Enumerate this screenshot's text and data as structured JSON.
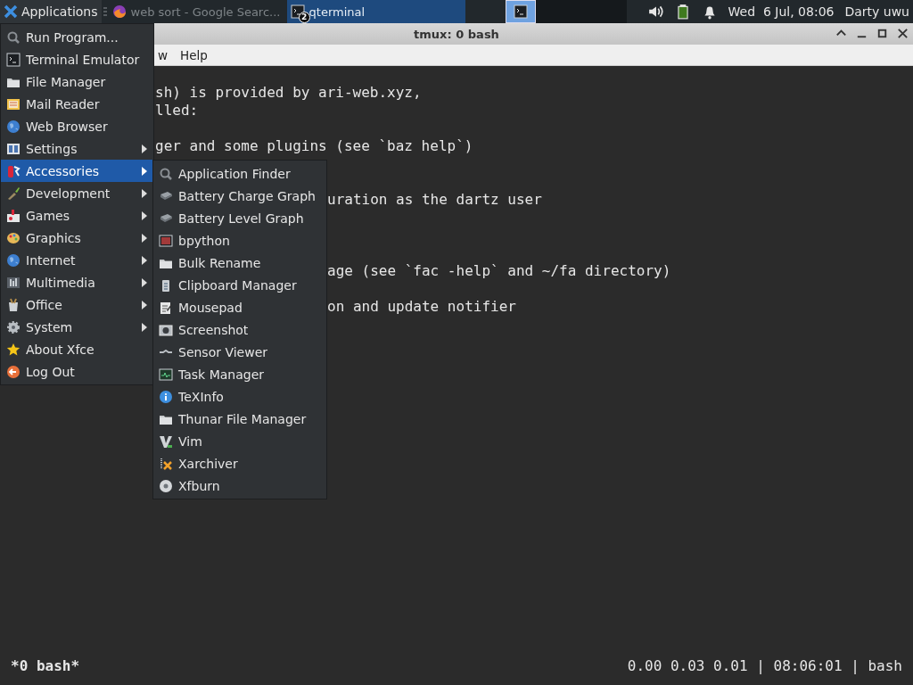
{
  "taskbar": {
    "apps_button": "Applications",
    "tasks": [
      {
        "label": "web sort - Google Searc...",
        "selected": false
      },
      {
        "label": "qterminal",
        "selected": true,
        "badge": "2"
      }
    ],
    "workspaces": [
      {
        "selected": true
      },
      {
        "selected": false
      },
      {
        "selected": false
      },
      {
        "selected": false
      }
    ],
    "clock": "Wed  6 Jul, 08:06",
    "user": "Darty uwu"
  },
  "window": {
    "title": "tmux: 0 bash",
    "menus": [
      "w",
      "Help"
    ]
  },
  "terminal": {
    "lines": [
      {
        "kind": "menu",
        "text": "sh) is provided by ari-web.xyz,"
      },
      {
        "kind": "menu",
        "text": "lled:"
      },
      {
        "kind": "blank"
      },
      {
        "kind": "menu",
        "text": "ger and some plugins (see `baz help`)"
      },
      {
        "kind": "blank"
      },
      {
        "kind": "blank"
      },
      {
        "kind": "submenu",
        "text": "uration as the dartz user"
      },
      {
        "kind": "blank"
      },
      {
        "kind": "blank"
      },
      {
        "kind": "blank"
      },
      {
        "kind": "submenu",
        "text": "age (see `fac -help` and ~/fa directory)"
      },
      {
        "kind": "blank"
      },
      {
        "kind": "submenu",
        "text": "on and update notifier"
      }
    ],
    "status_left": "*0 bash*",
    "status_right": "0.00 0.03 0.01 | 08:06:01 | bash"
  },
  "menu": {
    "items": [
      {
        "label": "Run Program...",
        "submenu": false,
        "selected": false
      },
      {
        "label": "Terminal Emulator",
        "submenu": false,
        "selected": false
      },
      {
        "label": "File Manager",
        "submenu": false,
        "selected": false
      },
      {
        "label": "Mail Reader",
        "submenu": false,
        "selected": false
      },
      {
        "label": "Web Browser",
        "submenu": false,
        "selected": false
      },
      {
        "label": "Settings",
        "submenu": true,
        "selected": false
      },
      {
        "label": "Accessories",
        "submenu": true,
        "selected": true
      },
      {
        "label": "Development",
        "submenu": true,
        "selected": false
      },
      {
        "label": "Games",
        "submenu": true,
        "selected": false
      },
      {
        "label": "Graphics",
        "submenu": true,
        "selected": false
      },
      {
        "label": "Internet",
        "submenu": true,
        "selected": false
      },
      {
        "label": "Multimedia",
        "submenu": true,
        "selected": false
      },
      {
        "label": "Office",
        "submenu": true,
        "selected": false
      },
      {
        "label": "System",
        "submenu": true,
        "selected": false
      },
      {
        "label": "About Xfce",
        "submenu": false,
        "selected": false
      },
      {
        "label": "Log Out",
        "submenu": false,
        "selected": false
      }
    ]
  },
  "submenu": {
    "items": [
      "Application Finder",
      "Battery Charge Graph",
      "Battery Level Graph",
      "bpython",
      "Bulk Rename",
      "Clipboard Manager",
      "Mousepad",
      "Screenshot",
      "Sensor Viewer",
      "Task Manager",
      "TeXInfo",
      "Thunar File Manager",
      "Vim",
      "Xarchiver",
      "Xfburn"
    ]
  }
}
